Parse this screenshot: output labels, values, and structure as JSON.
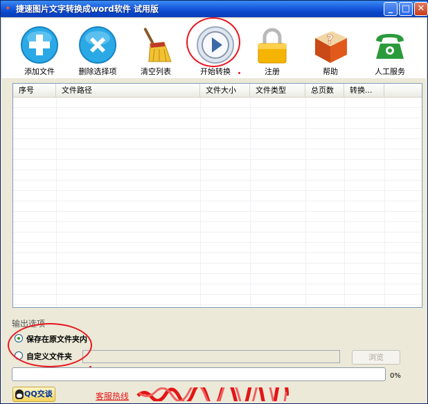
{
  "window": {
    "title": "捷速图片文字转换成word软件 试用版",
    "buttons": {
      "minimize": "_",
      "maximize": "□",
      "close": "✕"
    }
  },
  "toolbar": {
    "items": [
      {
        "label": "添加文件",
        "icon": "plus-icon",
        "color": "#2aa9e6"
      },
      {
        "label": "删除选择项",
        "icon": "x-icon",
        "color": "#2aa9e6"
      },
      {
        "label": "清空列表",
        "icon": "broom-icon",
        "color": "#e9b43a"
      },
      {
        "label": "开始转换",
        "icon": "play-icon",
        "color": "#3c6aa8"
      },
      {
        "label": "注册",
        "icon": "lock-icon",
        "color": "#f4b400"
      },
      {
        "label": "帮助",
        "icon": "help-book-icon",
        "color": "#e25a1b"
      },
      {
        "label": "人工服务",
        "icon": "phone-icon",
        "color": "#2b9a3b"
      }
    ]
  },
  "table": {
    "columns": [
      "序号",
      "文件路径",
      "文件大小",
      "文件类型",
      "总页数",
      "转换..."
    ],
    "rows": []
  },
  "output": {
    "group_title": "输出选项",
    "option_original": "保存在原文件夹内",
    "option_custom": "自定义文件夹",
    "custom_path": "",
    "browse_label": "浏览",
    "selected": "original"
  },
  "progress": {
    "value": 0,
    "text": "0%"
  },
  "footer": {
    "qq_label": "QQ交谈",
    "hotline_label": "客服热线"
  },
  "colors": {
    "annotation_red": "#e8141b",
    "titlebar": "#0a46c9"
  }
}
